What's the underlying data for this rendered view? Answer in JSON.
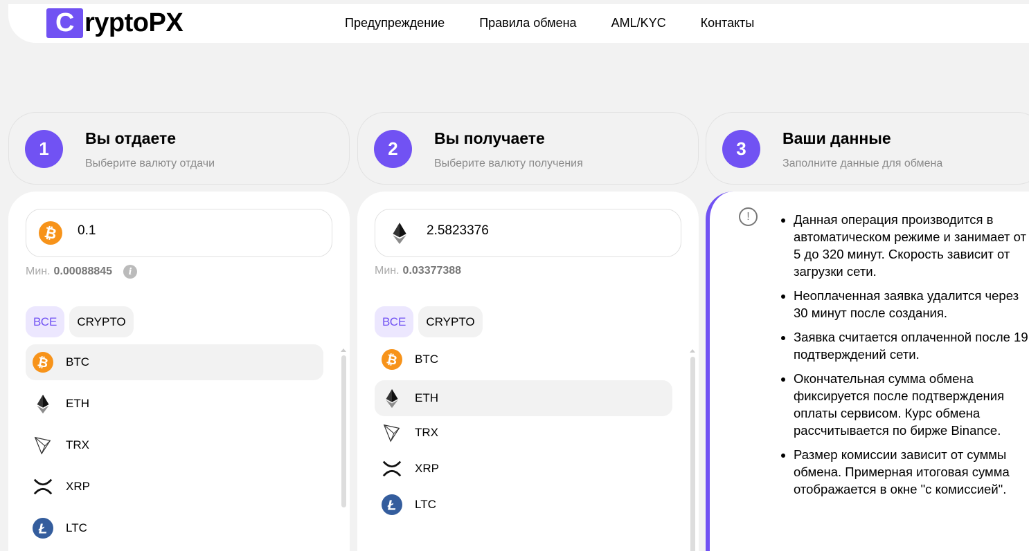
{
  "header": {
    "logo_letter": "C",
    "logo_rest": "ryptoPX",
    "nav": [
      "Предупреждение",
      "Правила обмена",
      "AML/KYC",
      "Контакты"
    ]
  },
  "steps": [
    {
      "num": "1",
      "title": "Вы отдаете",
      "subtitle": "Выберите валюту отдачи"
    },
    {
      "num": "2",
      "title": "Вы получаете",
      "subtitle": "Выберите валюту получения"
    },
    {
      "num": "3",
      "title": "Ваши данные",
      "subtitle": "Заполните данные для обмена"
    }
  ],
  "give": {
    "amount": "0.1",
    "min_label": "Мин.",
    "min_value": "0.00088845",
    "selected": "BTC"
  },
  "get": {
    "amount": "2.5823376",
    "min_label": "Мин.",
    "min_value": "0.03377388",
    "selected": "ETH"
  },
  "filters": [
    "ВСЕ",
    "CRYPTO"
  ],
  "currencies": [
    "BTC",
    "ETH",
    "TRX",
    "XRP",
    "LTC"
  ],
  "colors": {
    "accent": "#7152f3",
    "btc": "#f7931a",
    "ltc": "#345d9d"
  },
  "info_items": [
    "Данная операция производится в автоматическом режиме и занимает от 5 до 320 минут. Скорость зависит от загрузки сети.",
    "Неоплаченная заявка удалится через 30 минут после создания.",
    "Заявка считается оплаченной после 19 подтверждений сети.",
    "Окончательная сумма обмена фиксируется после подтверждения оплаты сервисом. Курс обмена рассчитывается по бирже Binance.",
    "Размер комиссии зависит от суммы обмена. Примерная итоговая сумма отображается в окне \"с комиссией\"."
  ]
}
